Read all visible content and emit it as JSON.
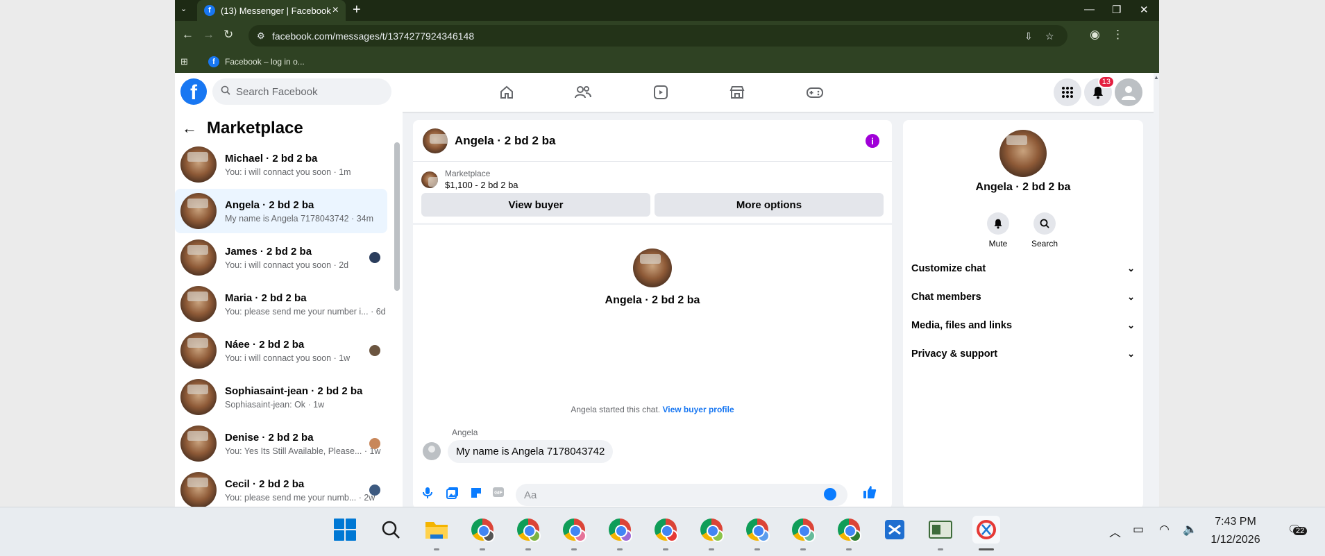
{
  "browser": {
    "tab_title": "(13) Messenger | Facebook",
    "new_tab_symbol": "+",
    "url": "facebook.com/messages/t/1374277924346148",
    "bookmark": "Facebook – log in o..."
  },
  "facebook_header": {
    "logo": "f",
    "search_placeholder": "Search Facebook",
    "notification_count": "13"
  },
  "left_panel": {
    "title": "Marketplace",
    "conversations": [
      {
        "name": "Michael · 2 bd 2 ba",
        "preview": "You: i will connact you soon · 1m",
        "active": false,
        "dot_color": ""
      },
      {
        "name": "Angela · 2 bd 2 ba",
        "preview": "My name is Angela 7178043742 · 34m",
        "active": true,
        "dot_color": ""
      },
      {
        "name": "James · 2 bd 2 ba",
        "preview": "You: i will connact you soon · 2d",
        "active": false,
        "dot_color": "#2a3d5c"
      },
      {
        "name": "Maria · 2 bd 2 ba",
        "preview": "You: please send me your number i... · 6d",
        "active": false,
        "dot_color": ""
      },
      {
        "name": "Náee · 2 bd 2 ba",
        "preview": "You: i will connact you soon · 1w",
        "active": false,
        "dot_color": "#6b5540"
      },
      {
        "name": "Sophiasaint-jean · 2 bd 2 ba",
        "preview": "Sophiasaint-jean: Ok · 1w",
        "active": false,
        "dot_color": ""
      },
      {
        "name": "Denise · 2 bd 2 ba",
        "preview": "You: Yes Its Still Available, Please... · 1w",
        "active": false,
        "dot_color": "#c8875a"
      },
      {
        "name": "Cecil · 2 bd 2 ba",
        "preview": "You: please send me your numb... · 2w",
        "active": false,
        "dot_color": "#3d5a80"
      }
    ]
  },
  "chat": {
    "title": "Angela · 2 bd 2 ba",
    "info_symbol": "i",
    "listing_label": "Marketplace",
    "listing_detail": "$1,100 - 2 bd 2 ba",
    "view_buyer": "View buyer",
    "more_options": "More options",
    "profile_name": "Angela · 2 bd 2 ba",
    "started_text": "Angela started this chat.",
    "view_buyer_profile": "View buyer profile",
    "sender": "Angela",
    "message": "My name is Angela 7178043742",
    "composer_placeholder": "Aa"
  },
  "right_panel": {
    "name": "Angela · 2 bd 2 ba",
    "mute": "Mute",
    "search": "Search",
    "sections": [
      "Customize chat",
      "Chat members",
      "Media, files and links",
      "Privacy & support"
    ]
  },
  "taskbar": {
    "time": "7:43 PM",
    "date": "1/12/2026",
    "notification_count": "22"
  },
  "colors": {
    "brand": "#1877f2",
    "messenger_accent": "#0a7cff",
    "info_icon": "#a000d8",
    "chrome_frame": "#2f4223",
    "active_conversation": "#ebf5ff"
  }
}
